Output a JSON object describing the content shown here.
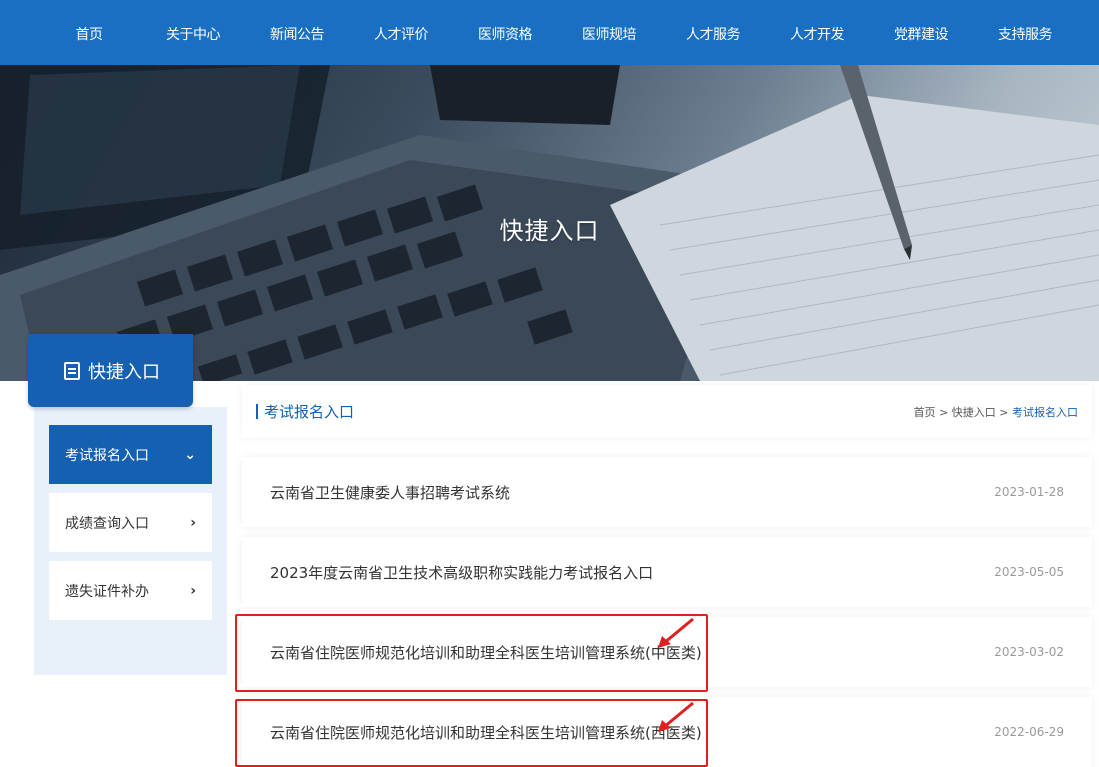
{
  "nav": [
    {
      "label": "首页"
    },
    {
      "label": "关于中心"
    },
    {
      "label": "新闻公告"
    },
    {
      "label": "人才评价"
    },
    {
      "label": "医师资格"
    },
    {
      "label": "医师规培"
    },
    {
      "label": "人才服务"
    },
    {
      "label": "人才开发"
    },
    {
      "label": "党群建设"
    },
    {
      "label": "支持服务"
    }
  ],
  "banner": {
    "title": "快捷入口"
  },
  "sidebar": {
    "header": "快捷入口",
    "items": [
      {
        "label": "考试报名入口",
        "chevron": "⌄",
        "active": true
      },
      {
        "label": "成绩查询入口",
        "chevron": "›",
        "active": false
      },
      {
        "label": "遗失证件补办",
        "chevron": "›",
        "active": false
      }
    ]
  },
  "content": {
    "section_title": "考试报名入口",
    "breadcrumb": {
      "home": "首页",
      "sep1": ">",
      "level2": "快捷入口",
      "sep2": ">",
      "current": "考试报名入口"
    },
    "rows": [
      {
        "title": "云南省卫生健康委人事招聘考试系统",
        "date": "2023-01-28"
      },
      {
        "title": "2023年度云南省卫生技术高级职称实践能力考试报名入口",
        "date": "2023-05-05"
      },
      {
        "title": "云南省住院医师规范化培训和助理全科医生培训管理系统(中医类)",
        "date": "2023-03-02"
      },
      {
        "title": "云南省住院医师规范化培训和助理全科医生培训管理系统(西医类)",
        "date": "2022-06-29"
      }
    ]
  },
  "colors": {
    "primary": "#1560b0",
    "nav": "#1a6fc2",
    "highlight": "#e02020"
  }
}
